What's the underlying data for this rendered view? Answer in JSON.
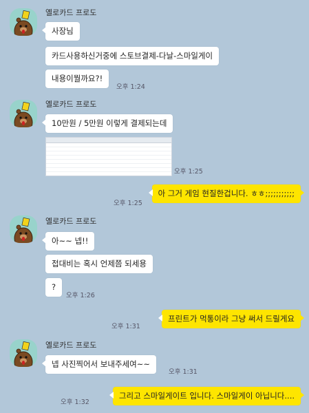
{
  "chat": {
    "sender_name": "옐로카드 프로도",
    "blocks": [
      {
        "messages": [
          "사장님",
          "카드사용하신거중에 스토브결제-다날-스마일게이",
          "내용이뭘까요?!"
        ],
        "time": "오후 1:24"
      },
      {
        "messages": [
          "10만원 / 5만원 이렇게 결제되는데"
        ],
        "image": {
          "label": "결제내역 스크린샷",
          "rows": 8
        },
        "time": "오후 1:25"
      },
      {
        "mine": true,
        "messages": [
          "아 그거 게임 현질한겁니다. ㅎㅎ;;;;;;;;;;;"
        ],
        "time": "오후 1:25"
      },
      {
        "messages": [
          "아~~ 넵!!",
          "접대비는 혹시 언제쯤 되세용",
          "?"
        ],
        "time": "오후 1:26"
      },
      {
        "mine": true,
        "messages": [
          "프린트가 먹통이라 그냥 써서 드릴게요"
        ],
        "time": "오후 1:31"
      },
      {
        "messages": [
          "넵 사진찍어서 보내주세여~~"
        ],
        "time": "오후 1:31"
      },
      {
        "mine": true,
        "messages": [
          "그리고 스마일게이트 입니다. 스마일게이 아닙니다...."
        ],
        "time": "오후 1:32"
      }
    ]
  },
  "colors": {
    "background": "#b2c7d9",
    "bubble_other": "#ffffff",
    "bubble_mine": "#fee500",
    "avatar_bg": "#98d3cb"
  },
  "icons": {
    "avatar": "bear-with-yellow-card-avatar"
  }
}
